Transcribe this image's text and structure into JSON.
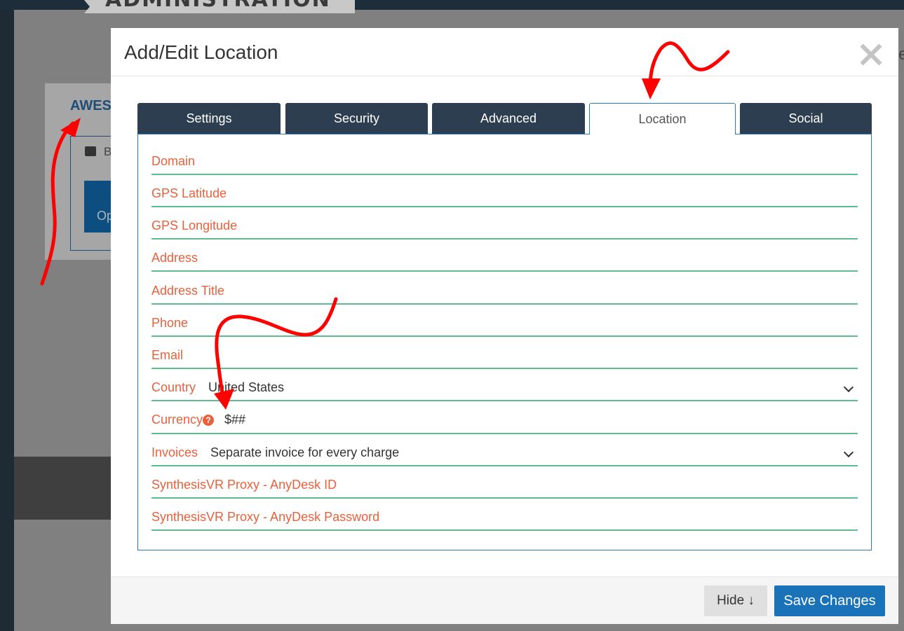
{
  "background": {
    "admin_title": "ADMINISTRATION",
    "card_title": "AWES",
    "card_text": "B",
    "card_button": "Op",
    "edge_letter": "e"
  },
  "modal": {
    "title": "Add/Edit Location",
    "tabs": [
      {
        "label": "Settings",
        "active": false
      },
      {
        "label": "Security",
        "active": false
      },
      {
        "label": "Advanced",
        "active": false
      },
      {
        "label": "Location",
        "active": true
      },
      {
        "label": "Social",
        "active": false
      }
    ],
    "fields": [
      {
        "label": "Domain",
        "value": ""
      },
      {
        "label": "GPS Latitude",
        "value": ""
      },
      {
        "label": "GPS Longitude",
        "value": ""
      },
      {
        "label": "Address",
        "value": ""
      },
      {
        "label": "Address Title",
        "value": ""
      },
      {
        "label": "Phone",
        "value": ""
      },
      {
        "label": "Email",
        "value": ""
      },
      {
        "label": "Country",
        "value": "United States",
        "type": "select"
      },
      {
        "label": "Currency",
        "value": "$##",
        "help_icon": "question-circle-icon"
      },
      {
        "label": "Invoices",
        "value": "Separate invoice for every charge",
        "type": "select"
      },
      {
        "label": "SynthesisVR Proxy - AnyDesk ID",
        "value": ""
      },
      {
        "label": "SynthesisVR Proxy - AnyDesk Password",
        "value": ""
      }
    ],
    "help_glyph": "?",
    "footer": {
      "hide_label": "Hide ↓",
      "save_label": "Save Changes"
    }
  },
  "colors": {
    "label": "#e8613d",
    "underline": "#5ebd8e",
    "tab_bg": "#2c3e4f",
    "primary": "#1a73b8",
    "annotation_arrow": "#ff0000"
  }
}
